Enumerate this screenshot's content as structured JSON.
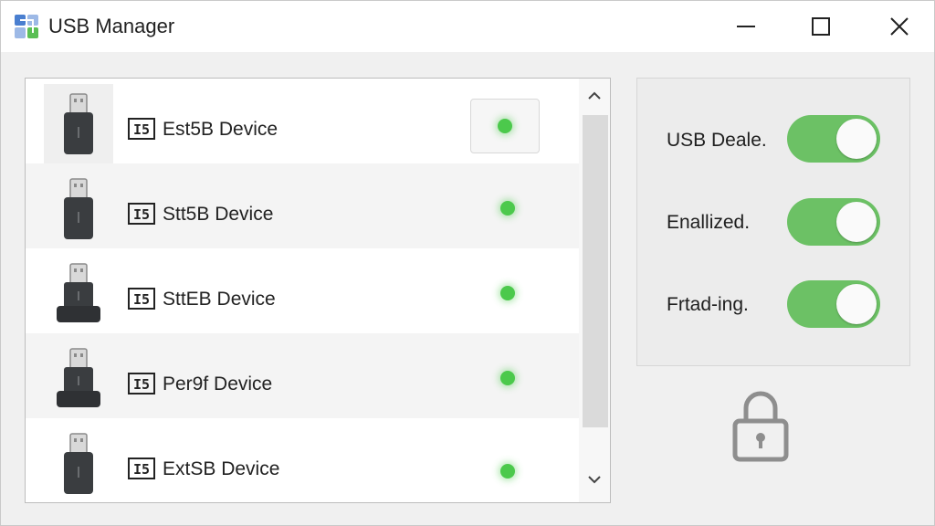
{
  "window": {
    "title": "USB Manager",
    "app_icon": "usb-manager-app-icon",
    "controls": [
      "minimize-icon",
      "maximize-icon",
      "close-icon"
    ]
  },
  "device_list": {
    "devices": [
      {
        "label": "Est5B Device",
        "icon": "usb-stick-icon",
        "status": "connected",
        "selected": true
      },
      {
        "label": "Stt5B Device",
        "icon": "usb-stick-icon",
        "status": "connected",
        "selected": false
      },
      {
        "label": "SttEB Device",
        "icon": "usb-drive-icon",
        "status": "connected",
        "selected": false
      },
      {
        "label": "Per9f Device",
        "icon": "usb-drive-icon",
        "status": "connected",
        "selected": false
      },
      {
        "label": "ExtSB Device",
        "icon": "usb-stick-icon",
        "status": "connected",
        "selected": false
      }
    ],
    "device_glyph": "device-type-icon",
    "scrollbar": {
      "up": "chevron-up-icon",
      "down": "chevron-down-icon"
    }
  },
  "settings": {
    "toggles": [
      {
        "label": "USB Deale.",
        "on": true
      },
      {
        "label": "Enallized.",
        "on": true
      },
      {
        "label": "Frtad-ing.",
        "on": true
      }
    ],
    "lock_icon": "padlock-icon"
  },
  "colors": {
    "accent_green": "#6cc165",
    "status_green": "#4cc94c",
    "background": "#f0f0f0"
  }
}
